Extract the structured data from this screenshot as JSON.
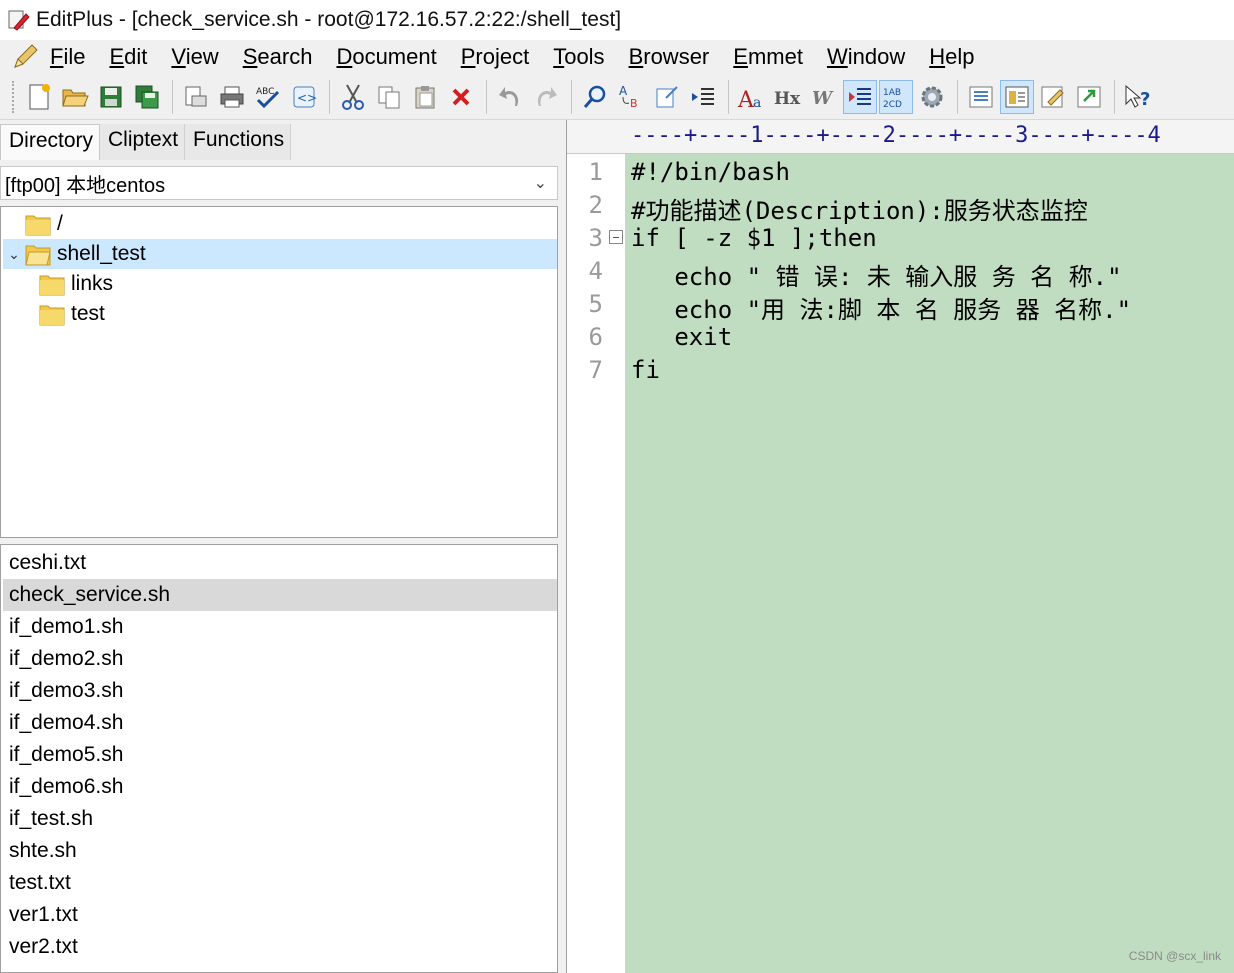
{
  "window": {
    "title": "EditPlus - [check_service.sh - root@172.16.57.2:22:/shell_test]"
  },
  "menu": [
    "File",
    "Edit",
    "View",
    "Search",
    "Document",
    "Project",
    "Tools",
    "Browser",
    "Emmet",
    "Window",
    "Help"
  ],
  "toolbar": {
    "icons": [
      "new-file-icon",
      "open-file-icon",
      "save-icon",
      "save-all-icon",
      "print-preview-icon",
      "print-icon",
      "spellcheck-icon",
      "browser-preview-icon",
      "cut-icon",
      "copy-icon",
      "paste-icon",
      "delete-icon",
      "undo-icon",
      "redo-icon",
      "find-icon",
      "replace-icon",
      "go-to-icon",
      "indent-icon",
      "font-icon",
      "hx-icon",
      "word-wrap-icon",
      "line-numbers-icon",
      "abcd-icon",
      "settings-icon",
      "view-icon",
      "panel-icon",
      "edit-icon",
      "export-icon",
      "help-icon"
    ]
  },
  "left_panel": {
    "tabs": [
      "Directory",
      "Cliptext",
      "Functions"
    ],
    "active_tab": "Directory",
    "ftp_account": "[ftp00] 本地centos",
    "tree": [
      {
        "label": "/",
        "indent": 1,
        "expanded": false
      },
      {
        "label": "shell_test",
        "indent": 0,
        "expanded": true,
        "selected": true
      },
      {
        "label": "links",
        "indent": 2
      },
      {
        "label": "test",
        "indent": 2
      }
    ],
    "files": [
      "ceshi.txt",
      "check_service.sh",
      "if_demo1.sh",
      "if_demo2.sh",
      "if_demo3.sh",
      "if_demo4.sh",
      "if_demo5.sh",
      "if_demo6.sh",
      "if_test.sh",
      "shte.sh",
      "test.txt",
      "ver1.txt",
      "ver2.txt"
    ],
    "selected_file": "check_service.sh"
  },
  "editor": {
    "ruler": "----+----1----+----2----+----3----+----4",
    "lines": [
      "#!/bin/bash",
      "#功能描述(Description):服务状态监控",
      "if [ -z $1 ];then",
      "   echo \" 错 误: 未 输入服 务 名 称.\"",
      "   echo \"用 法:脚 本 名 服务 器 名称.\"",
      "   exit",
      "fi"
    ],
    "background_color": "#c1ddc1"
  },
  "watermark": "CSDN @scx_link"
}
